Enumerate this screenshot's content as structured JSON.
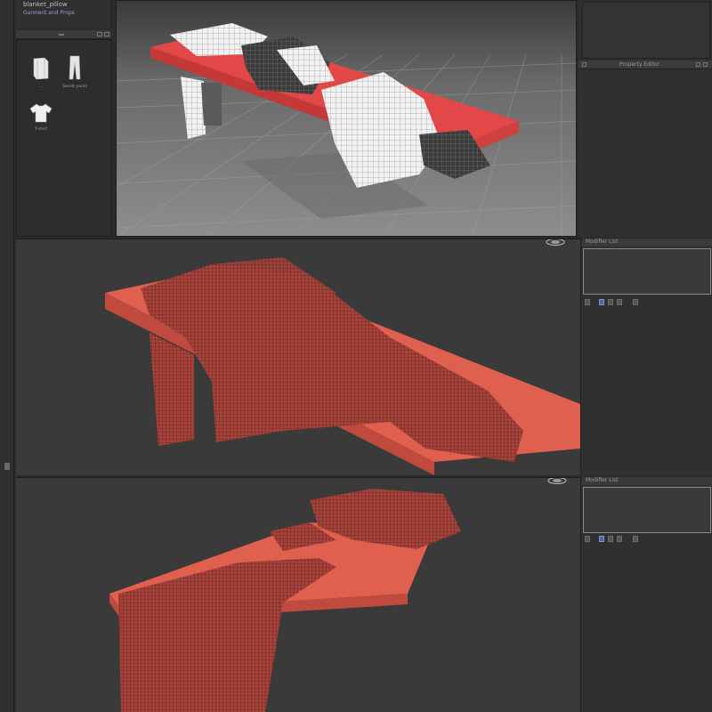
{
  "library": {
    "path_label": "blanket_pillow",
    "link_label": "Garment and Props",
    "items": [
      {
        "icon": "blanket-icon",
        "label": "..."
      },
      {
        "icon": "pants-icon",
        "label": "Sweat pants"
      },
      {
        "icon": "tshirt-icon",
        "label": "T-shirt"
      }
    ]
  },
  "right_panel": {
    "top_bar_label": "Property Editor",
    "section_labels": [
      "Modifier List",
      "Modifier List"
    ]
  },
  "colors": {
    "bench_red": "#e24848",
    "mesh_red": "#b0443a",
    "viewport_bg": "#3a3a3a",
    "selection_blue": "#4a66a8"
  }
}
